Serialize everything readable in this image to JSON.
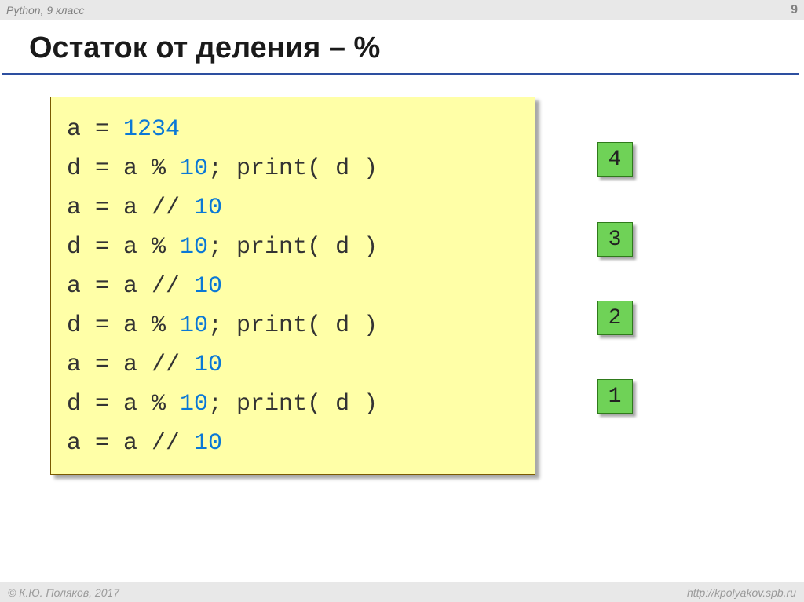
{
  "header": {
    "course": "Python, 9 класс",
    "page_number": "9"
  },
  "title": "Остаток от деления – %",
  "code": {
    "lines": [
      {
        "pre": "a = ",
        "num": "1234",
        "post": ""
      },
      {
        "pre": "d = a % ",
        "num": "10",
        "post": "; print( d ) "
      },
      {
        "pre": "a = a // ",
        "num": "10",
        "post": ""
      },
      {
        "pre": "d = a % ",
        "num": "10",
        "post": "; print( d ) "
      },
      {
        "pre": "a = a // ",
        "num": "10",
        "post": ""
      },
      {
        "pre": "d = a % ",
        "num": "10",
        "post": "; print( d ) "
      },
      {
        "pre": "a = a // ",
        "num": "10",
        "post": ""
      },
      {
        "pre": "d = a % ",
        "num": "10",
        "post": "; print( d ) "
      },
      {
        "pre": "a = a // ",
        "num": "10",
        "post": " "
      }
    ]
  },
  "results": [
    "4",
    "3",
    "2",
    "1"
  ],
  "footer": {
    "copyright": "© К.Ю. Поляков, 2017",
    "url": "http://kpolyakov.spb.ru"
  }
}
